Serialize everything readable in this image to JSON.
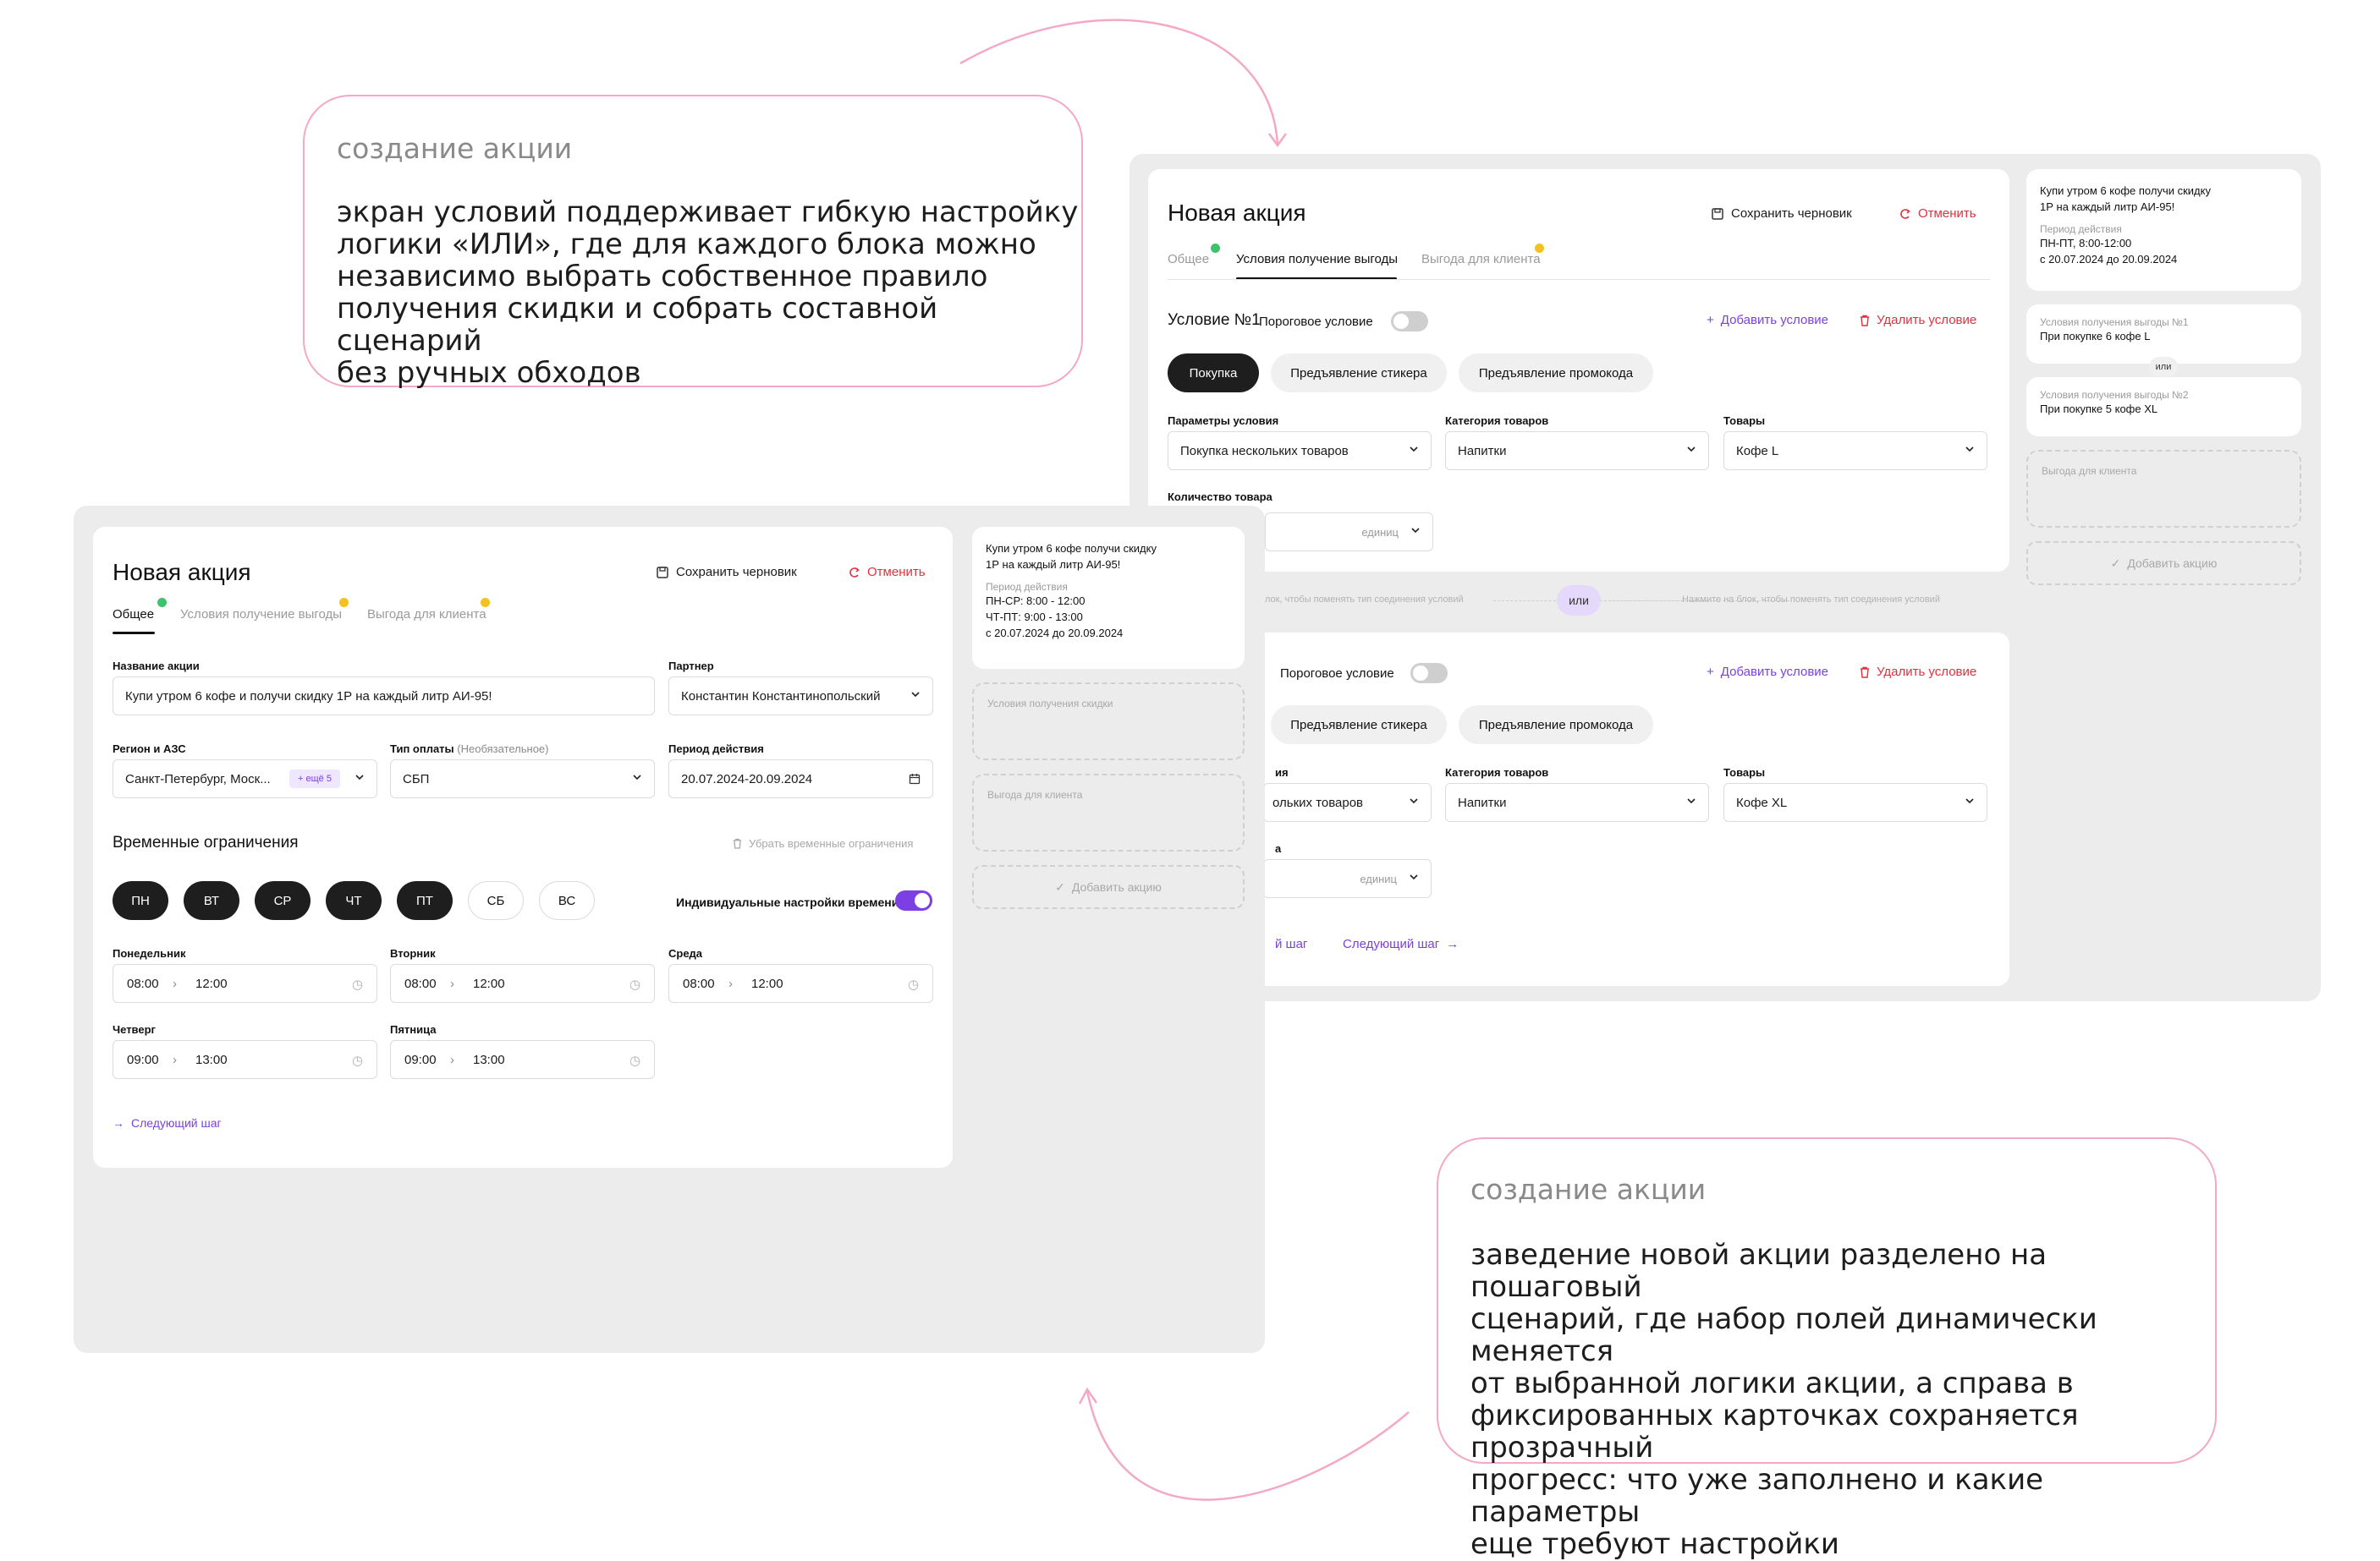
{
  "callout_top": {
    "title": "создание акции",
    "lines": [
      "экран условий поддерживает гибкую настройку",
      "логики «ИЛИ», где для каждого блока можно",
      "независимо выбрать собственное правило",
      "получения скидки и собрать составной сценарий",
      "без ручных обходов"
    ]
  },
  "callout_bottom": {
    "title": "создание акции",
    "lines": [
      "заведение новой акции разделено на пошаговый",
      "сценарий, где набор полей динамически меняется",
      "от выбранной логики акции, а справа в",
      "фиксированных карточках сохраняется прозрачный",
      "прогресс: что уже заполнено и какие параметры",
      "еще требуют настройки"
    ]
  },
  "accent_colors": {
    "purple": "#7b3fe4",
    "red": "#e0303d",
    "pink_line": "#f3a9c6",
    "green": "#3fc26b",
    "yellow": "#f4c11e"
  },
  "screen_back": {
    "title": "Новая акция",
    "save_draft": "Сохранить черновик",
    "cancel": "Отменить",
    "tabs": [
      "Общее",
      "Условия получение выгоды",
      "Выгода для клиента"
    ],
    "condition1": {
      "title": "Условие №1",
      "threshold_label": "Пороговое условие",
      "add_condition": "Добавить условие",
      "delete_condition": "Удалить условие",
      "types": [
        "Покупка",
        "Предъявление стикера",
        "Предъявление промокода"
      ],
      "params_label": "Параметры условия",
      "params_value": "Покупка нескольких товаров",
      "category_label": "Категория товаров",
      "category_value": "Напитки",
      "goods_label": "Товары",
      "goods_value": "Кофе L",
      "qty_label": "Количество товара",
      "qty_placeholder": "единиц"
    },
    "or_hint_left": "лок, чтобы поменять тип соединения условий",
    "or_label": "или",
    "or_hint_right": "Нажмите на блок, чтобы поменять тип соединения условий",
    "condition2": {
      "threshold_label": "Пороговое условие",
      "add_condition": "Добавить условие",
      "delete_condition": "Удалить условие",
      "types": [
        "Предъявление стикера",
        "Предъявление промокода"
      ],
      "params_label_partial": "ия",
      "params_value_partial": "ольких товаров",
      "category_label": "Категория товаров",
      "category_value": "Напитки",
      "goods_label": "Товары",
      "goods_value": "Кофе XL",
      "qty_label_partial": "а",
      "qty_placeholder": "единиц"
    },
    "prev_step_partial": "й шаг",
    "next_step": "Следующий шаг",
    "side": {
      "promo_text": [
        "Купи утром 6 кофе получи скидку",
        "1Р на каждый литр АИ-95!"
      ],
      "period_label": "Период действия",
      "period_lines": [
        "ПН-ПТ, 8:00-12:00",
        "с 20.07.2024 до 20.09.2024"
      ],
      "cond1_label": "Условия получения выгоды №1",
      "cond1_value": "При покупке 6 кофе L",
      "or_label": "или",
      "cond2_label": "Условия получения выгоды №2",
      "cond2_value": "При покупке 5 кофе XL",
      "benefit_label": "Выгода для клиента",
      "add_promo": "Добавить акцию"
    }
  },
  "screen_front": {
    "title": "Новая акция",
    "save_draft": "Сохранить черновик",
    "cancel": "Отменить",
    "tabs": [
      "Общее",
      "Условия получение выгоды",
      "Выгода для клиента"
    ],
    "name_label": "Название акции",
    "name_value": "Купи утром 6 кофе и получи скидку 1Р на каждый литр АИ-95!",
    "partner_label": "Партнер",
    "partner_value": "Константин Константинопольский",
    "region_label": "Регион и АЗС",
    "region_value": "Санкт-Петербург, Моск...",
    "region_badge": "+ ещё 5",
    "payment_label": "Тип оплаты",
    "payment_optional": "(Необязательное)",
    "payment_value": "СБП",
    "period_label": "Период действия",
    "period_value": "20.07.2024-20.09.2024",
    "time_limits_title": "Временные ограничения",
    "remove_time_limits": "Убрать временные ограничения",
    "days": [
      {
        "label": "ПН",
        "active": true
      },
      {
        "label": "ВТ",
        "active": true
      },
      {
        "label": "СР",
        "active": true
      },
      {
        "label": "ЧТ",
        "active": true
      },
      {
        "label": "ПТ",
        "active": true
      },
      {
        "label": "СБ",
        "active": false
      },
      {
        "label": "ВС",
        "active": false
      }
    ],
    "individual_time_label": "Индивидуальные настройки времени",
    "schedule": [
      {
        "day": "Понедельник",
        "from": "08:00",
        "to": "12:00"
      },
      {
        "day": "Вторник",
        "from": "08:00",
        "to": "12:00"
      },
      {
        "day": "Среда",
        "from": "08:00",
        "to": "12:00"
      },
      {
        "day": "Четверг",
        "from": "09:00",
        "to": "13:00"
      },
      {
        "day": "Пятница",
        "from": "09:00",
        "to": "13:00"
      }
    ],
    "next_step": "Следующий шаг",
    "side": {
      "promo_text": [
        "Купи утром 6 кофе получи скидку",
        "1Р на каждый литр АИ-95!"
      ],
      "period_label": "Период действия",
      "period_lines": [
        "ПН-СР: 8:00 - 12:00",
        "ЧТ-ПТ: 9:00 - 13:00",
        "с 20.07.2024 до 20.09.2024"
      ],
      "discount_label": "Условия получения скидки",
      "benefit_label": "Выгода для клиента",
      "add_promo": "Добавить акцию"
    }
  }
}
